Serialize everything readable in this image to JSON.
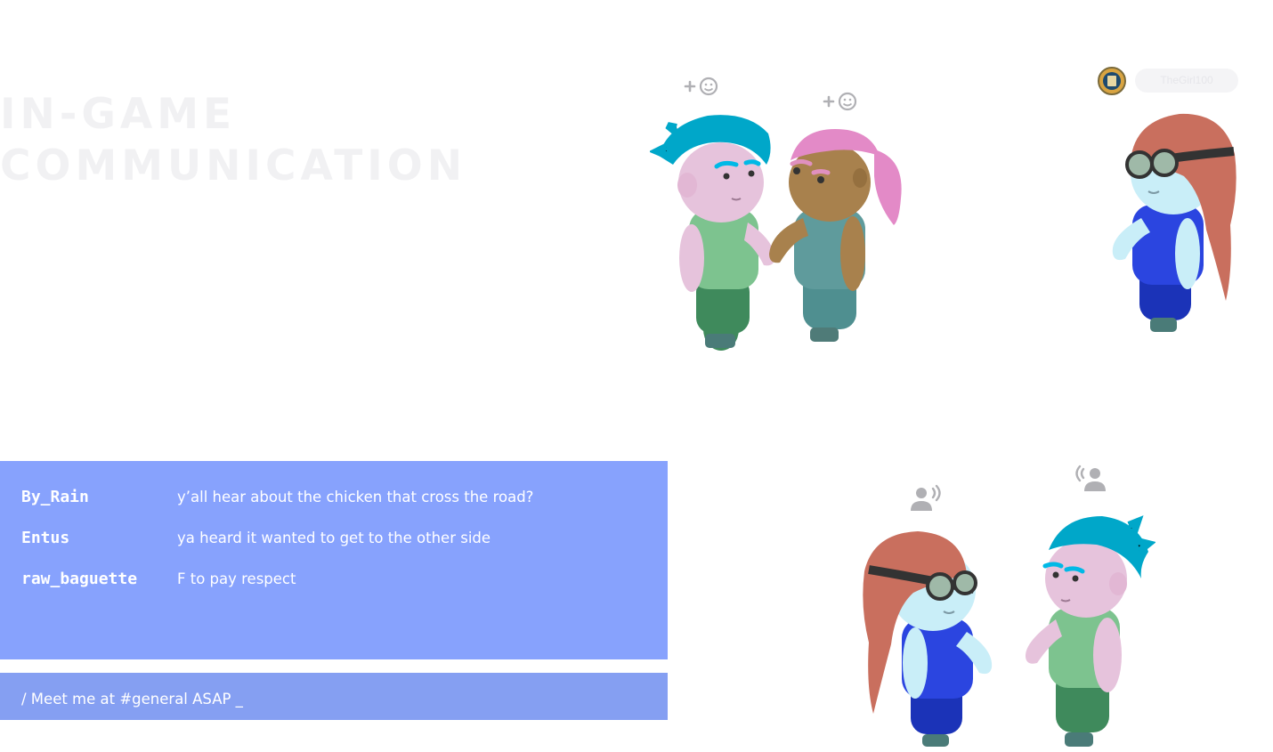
{
  "title": {
    "line1": "IN-GAME",
    "line2": "COMMUNICATION"
  },
  "chat": {
    "messages": [
      {
        "user": "By_Rain",
        "text": "y’all hear about the chicken that cross the road?"
      },
      {
        "user": "Entus",
        "text": "ya heard it wanted to get to the other side"
      },
      {
        "user": "raw_baguette",
        "text": "F to pay respect"
      }
    ],
    "input_value": "/ Meet me at #general ASAP _"
  },
  "player_tag": {
    "name": "TheGirl100"
  },
  "icons": {
    "emote": "add-emote-icon",
    "voice": "voice-chat-icon",
    "badge": "badge-icon"
  },
  "colors": {
    "chat_bg": "#87a2fd",
    "input_bg": "#859ff2",
    "title": "#f1f1f3",
    "icon_gray": "#b0b0b4"
  }
}
